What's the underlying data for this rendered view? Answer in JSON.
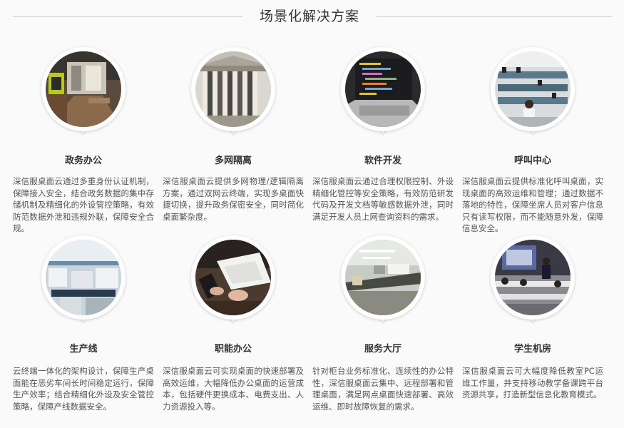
{
  "header": {
    "title": "场景化解决方案"
  },
  "scenarios": [
    {
      "title": "政务办公",
      "icon": "government-office-photo",
      "desc": "深信服桌面云通过多重身份认证机制，保障接入安全，结合政务数据的集中存储机制及精细化的外设管控策略，有效防范数据外泄和违规外联，保障安全合规。"
    },
    {
      "title": "多网隔离",
      "icon": "columned-building-photo",
      "desc": "深信服桌面云提供多网物理/逻辑隔离方案，通过双网云终端，实现多桌面快捷切换，提升政务保密安全，同时简化桌面繁杂度。"
    },
    {
      "title": "软件开发",
      "icon": "laptop-code-photo",
      "desc": "深信服桌面云通过合理权限控制、外设精细化管控等安全策略，有效防范研发代码及开发文档等敏感数据外泄，同时满足开发人员上网查询资料的需求。"
    },
    {
      "title": "呼叫中心",
      "icon": "call-center-photo",
      "desc": "深信服桌面云提供标准化呼叫桌面，实现桌面的高效运维和管理；通过数据不落地的特性，保障坐席人员对客户信息只有读写权限，而不能随意外发，保障信息安全。"
    },
    {
      "title": "生产线",
      "icon": "production-line-photo",
      "desc": "云终端一体化的架构设计，保障生产桌面能在恶劣车间长时间稳定运行，保障生产效率；结合精细化外设及安全管控策略，保障产线数据安全。"
    },
    {
      "title": "职能办公",
      "icon": "office-desk-photo",
      "desc": "深信服桌面云可实现桌面的快速部署及高效运维，大幅降低办公桌面的运营成本，包括硬件更换成本、电费支出、人力资源投入等。"
    },
    {
      "title": "服务大厅",
      "icon": "service-hall-photo",
      "desc": "针对柜台业务标准化、连续性的办公特性，深信服桌面云集中、远程部署和管理桌面，满足网点桌面快速部署、高效运维、即时故障恢复的需求。"
    },
    {
      "title": "学生机房",
      "icon": "classroom-photo",
      "desc": "深信服桌面云可大幅度降低教室PC运维工作量，并支持移动教学备课跨平台资源共享，打造新型信息化教育模式。"
    }
  ]
}
